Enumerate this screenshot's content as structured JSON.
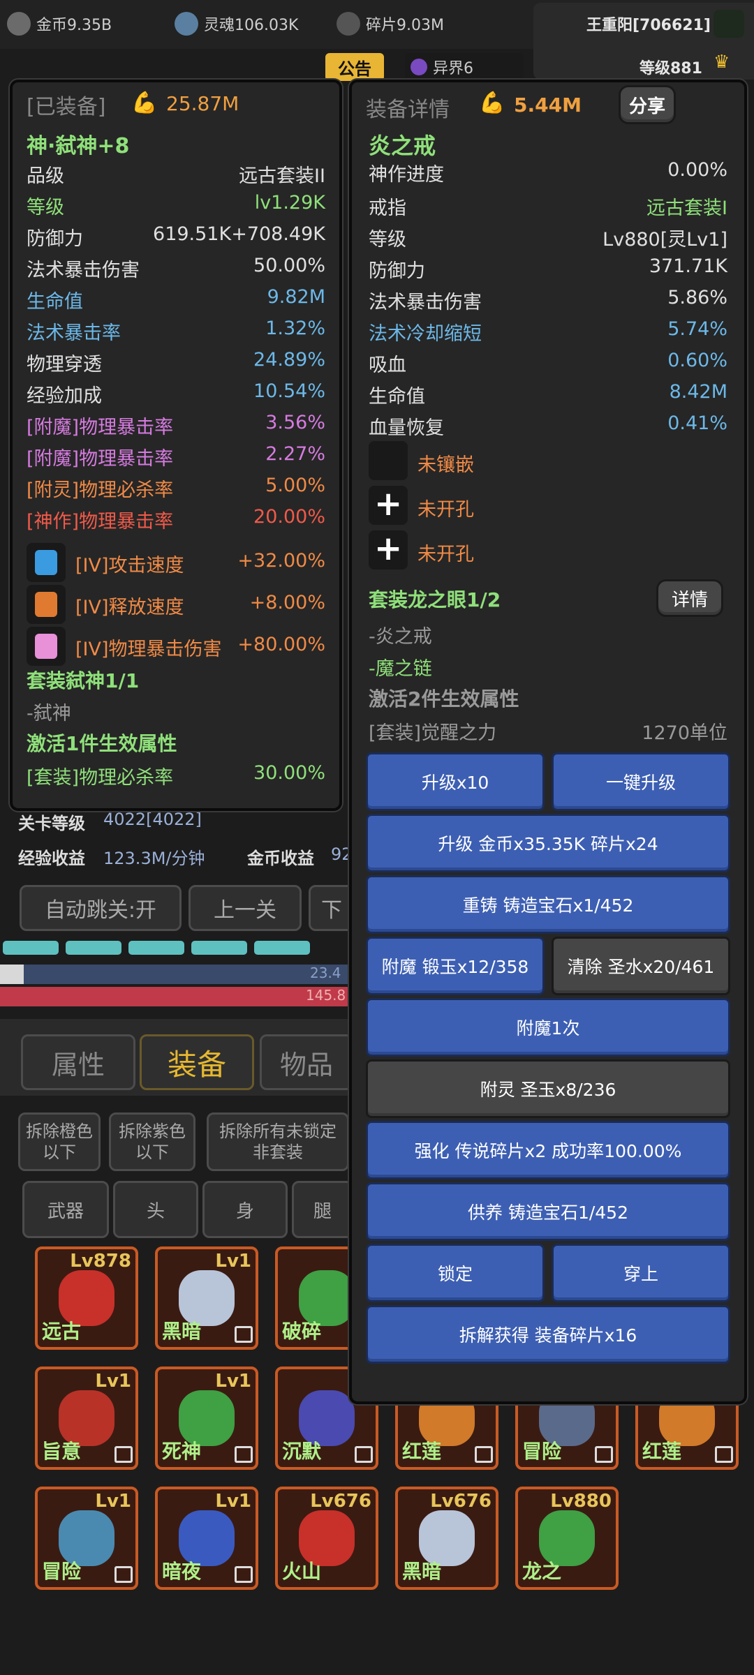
{
  "top": {
    "gold": "金币9.35B",
    "soul": "灵魂106.03K",
    "shard": "碎片9.03M",
    "player_name": "王重阳[706621]",
    "level": "等级881",
    "notice": "公告",
    "otherworld": "异界6"
  },
  "left_panel": {
    "header": "[已装备]",
    "power": "25.87M",
    "item_name": "神·弑神+8",
    "stats": [
      {
        "label": "品级",
        "value": "远古套装II"
      },
      {
        "label": "等级",
        "value": "lv1.29K"
      },
      {
        "label": "防御力",
        "value": "619.51K+708.49K"
      },
      {
        "label": "法术暴击伤害",
        "value": "50.00%"
      },
      {
        "label": "生命值",
        "value": "9.82M"
      },
      {
        "label": "法术暴击率",
        "value": "1.32%"
      },
      {
        "label": "物理穿透",
        "value": "24.89%"
      },
      {
        "label": "经验加成",
        "value": "10.54%"
      },
      {
        "label": "[附魔]物理暴击率",
        "value": "3.56%"
      },
      {
        "label": "[附魔]物理暴击率",
        "value": "2.27%"
      },
      {
        "label": "[附灵]物理必杀率",
        "value": "5.00%"
      },
      {
        "label": "[神作]物理暴击率",
        "value": "20.00%"
      }
    ],
    "gems": [
      {
        "label": "[IV]攻击速度",
        "value": "+32.00%"
      },
      {
        "label": "[IV]释放速度",
        "value": "+8.00%"
      },
      {
        "label": "[IV]物理暴击伤害",
        "value": "+80.00%"
      }
    ],
    "set_title": "套装弑神1/1",
    "set_item": "-弑神",
    "set_activate": "激活1件生效属性",
    "set_bonus_label": "[套装]物理必杀率",
    "set_bonus_value": "30.00%"
  },
  "right_panel": {
    "header": "装备详情",
    "power": "5.44M",
    "share": "分享",
    "item_name": "炎之戒",
    "progress_label": "神作进度",
    "progress_value": "0.00%",
    "stats": [
      {
        "label": "戒指",
        "value": "远古套装I"
      },
      {
        "label": "等级",
        "value": "Lv880[灵Lv1]"
      },
      {
        "label": "防御力",
        "value": "371.71K"
      },
      {
        "label": "法术暴击伤害",
        "value": "5.86%"
      },
      {
        "label": "法术冷却缩短",
        "value": "5.74%"
      },
      {
        "label": "吸血",
        "value": "0.60%"
      },
      {
        "label": "生命值",
        "value": "8.42M"
      },
      {
        "label": "血量恢复",
        "value": "0.41%"
      }
    ],
    "sockets": [
      "未镶嵌",
      "未开孔",
      "未开孔"
    ],
    "set_title": "套装龙之眼1/2",
    "detail_btn": "详情",
    "set_item1": "-炎之戒",
    "set_item2": "-魔之链",
    "set_activate": "激活2件生效属性",
    "set_bonus_label": "[套装]觉醒之力",
    "set_bonus_value": "1270单位",
    "buttons": {
      "upgrade10": "升级x10",
      "upgrade_all": "一键升级",
      "upgrade_cost": "升级 金币x35.35K 碎片x24",
      "recast": "重铸 铸造宝石x1/452",
      "enchant_cost": "附魔 锻玉x12/358",
      "clear": "清除 圣水x20/461",
      "enchant_once": "附魔1次",
      "spirit": "附灵 圣玉x8/236",
      "strengthen": "强化 传说碎片x2 成功率100.00%",
      "nourish": "供养 铸造宝石1/452",
      "lock": "锁定",
      "wear": "穿上",
      "dismantle": "拆解获得 装备碎片x16"
    }
  },
  "stage": {
    "stage_label": "关卡等级",
    "stage_value": "4022[4022]",
    "exp_label": "经验收益",
    "exp_value": "123.3M/分钟",
    "gold_label": "金币收益",
    "gold_value": "92",
    "auto_jump": "自动跳关:开",
    "prev": "上一关",
    "next": "下",
    "bar1_text": "23.4",
    "bar2_text": "145.8"
  },
  "tabs": {
    "attr": "属性",
    "equip": "装备",
    "items": "物品"
  },
  "filters": {
    "orange": "拆除橙色以下",
    "purple": "拆除紫色以下",
    "all": "拆除所有未锁定非套装",
    "weapon": "武器",
    "head": "头",
    "body": "身",
    "legs": "腿"
  },
  "inventory": [
    {
      "lv": "Lv878",
      "name": "远古",
      "lock": false
    },
    {
      "lv": "Lv1",
      "name": "黑暗",
      "lock": true
    },
    {
      "lv": "",
      "name": "破碎",
      "lock": false
    },
    {
      "lv": "Lv1",
      "name": "旨意",
      "lock": true
    },
    {
      "lv": "Lv1",
      "name": "死神",
      "lock": true
    },
    {
      "lv": "",
      "name": "沉默",
      "lock": true
    },
    {
      "lv": "",
      "name": "红莲",
      "lock": true
    },
    {
      "lv": "",
      "name": "冒险",
      "lock": true
    },
    {
      "lv": "",
      "name": "红莲",
      "lock": true
    },
    {
      "lv": "Lv1",
      "name": "冒险",
      "lock": true
    },
    {
      "lv": "Lv1",
      "name": "暗夜",
      "lock": true
    },
    {
      "lv": "Lv676",
      "name": "火山",
      "lock": false
    },
    {
      "lv": "Lv676",
      "name": "黑暗",
      "lock": false
    },
    {
      "lv": "Lv880",
      "name": "龙之",
      "lock": false
    }
  ]
}
